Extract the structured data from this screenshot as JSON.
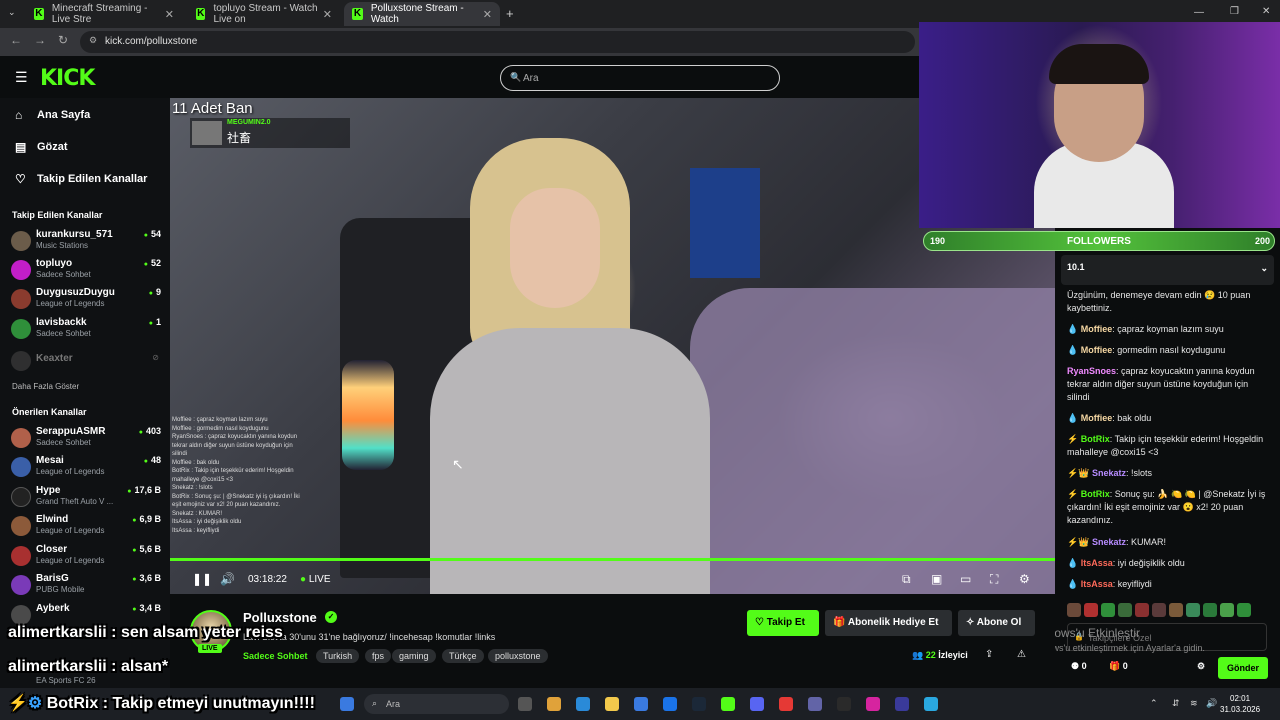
{
  "browser": {
    "tabs": [
      {
        "title": "Minecraft Streaming - Live Stre",
        "active": false
      },
      {
        "title": "topluyo Stream - Watch Live on",
        "active": false
      },
      {
        "title": "Polluxstone Stream - Watch",
        "active": true
      }
    ],
    "url": "kick.com/polluxstone"
  },
  "header": {
    "logo": "KICK",
    "search_placeholder": "Ara"
  },
  "sidebar": {
    "nav": [
      {
        "label": "Ana Sayfa",
        "icon": "home-icon"
      },
      {
        "label": "Gözat",
        "icon": "browse-icon"
      },
      {
        "label": "Takip Edilen Kanallar",
        "icon": "heart-icon"
      }
    ],
    "followed_title": "Takip Edilen Kanallar",
    "followed": [
      {
        "name": "kurankursu_571",
        "category": "Music Stations",
        "viewers": "54",
        "color": "#6b5c4a"
      },
      {
        "name": "topluyo",
        "category": "Sadece Sohbet",
        "viewers": "52",
        "color": "#c21ec8"
      },
      {
        "name": "DuygusuzDuygu",
        "category": "League of Legends",
        "viewers": "9",
        "color": "#8a3b2e"
      },
      {
        "name": "lavisbackk",
        "category": "Sadece Sohbet",
        "viewers": "1",
        "color": "#2f8f3a"
      }
    ],
    "offline": "Keaxter",
    "more_label": "Daha Fazla Göster",
    "recommended_title": "Önerilen Kanallar",
    "recommended": [
      {
        "name": "SerappuASMR",
        "category": "Sadece Sohbet",
        "viewers": "403",
        "color": "#b0604a"
      },
      {
        "name": "Mesai",
        "category": "League of Legends",
        "viewers": "48",
        "color": "#3a5fa8"
      },
      {
        "name": "Hype",
        "category": "Grand Theft Auto V ...",
        "viewers": "17,6 B",
        "color": "#222"
      },
      {
        "name": "Elwind",
        "category": "League of Legends",
        "viewers": "6,9 B",
        "color": "#8c5a3a"
      },
      {
        "name": "Closer",
        "category": "League of Legends",
        "viewers": "5,6 B",
        "color": "#a83030"
      },
      {
        "name": "BarisG",
        "category": "PUBG Mobile",
        "viewers": "3,6 B",
        "color": "#7a3ab8"
      },
      {
        "name": "Ayberk",
        "category": "",
        "viewers": "3,4 B",
        "color": "#4a4a4a"
      }
    ],
    "partial_category": "EA Sports FC 26"
  },
  "video": {
    "ban_overlay": "11 Adet Ban",
    "overlay_user": "MEGUMIN2.0",
    "overlay_text": "社畜",
    "overlay_chat": [
      "Moffiee : çapraz koyman lazım suyu",
      "Moffiee : gormedim nasıl koydugunu",
      "RyanSnoes : çapraz koyucaktın yanına koydun tekrar aldın diğer suyun üstüne koyduğun için silindi",
      "Moffiee : bak oldu",
      "BotRix : Takip için teşekkür ederim! Hoşgeldin mahalleye @coxi15 <3",
      "Snekatz : !slots",
      "BotRix : Sonuç şu: | @Snekatz iyi iş çıkardın! İki eşit emojiniz var x2! 20 puan kazandınız.",
      "Snekatz : KUMAR!",
      "ItsAssa : iyi değişiklik oldu",
      "ItsAssa : keyifliydi"
    ],
    "time": "03:18:22",
    "live_label": "LIVE"
  },
  "webcam": {
    "follow_goal": {
      "current": "190",
      "label": "FOLLOWERS",
      "target": "200",
      "progress": 0.95
    }
  },
  "chat": {
    "pinned": "10.1",
    "messages": [
      {
        "user": "",
        "color": "#fff",
        "text": "Üzgünüm, denemeye devam edin 😢 10 puan kaybettiniz."
      },
      {
        "user": "Moffiee",
        "color": "#f5d7a3",
        "text": "çapraz koyman lazım suyu"
      },
      {
        "user": "Moffiee",
        "color": "#f5d7a3",
        "text": "gormedim nasıl koydugunu"
      },
      {
        "user": "RyanSnoes",
        "color": "#f08aff",
        "text": "çapraz koyucaktın yanına koydun tekrar aldın diğer suyun üstüne koyduğun için silindi"
      },
      {
        "user": "Moffiee",
        "color": "#f5d7a3",
        "text": "bak oldu"
      },
      {
        "user": "BotRix",
        "color": "#53fc18",
        "text": "Takip için teşekkür ederim! Hoşgeldin mahalleye @coxi15 <3"
      },
      {
        "user": "Snekatz",
        "color": "#b78cff",
        "text": "!slots"
      },
      {
        "user": "BotRix",
        "color": "#53fc18",
        "text": "Sonuç şu: 🍌 🍋 🍋 | @Snekatz İyi iş çıkardın! İki eşit emojiniz var 😮 x2! 20 puan kazandınız."
      },
      {
        "user": "Snekatz",
        "color": "#b78cff",
        "text": "KUMAR!"
      },
      {
        "user": "ItsAssa",
        "color": "#ff6a5a",
        "text": "iyi değişiklik oldu"
      },
      {
        "user": "ItsAssa",
        "color": "#ff6a5a",
        "text": "keyifliydi"
      }
    ],
    "input_placeholder": "Takipçilere Özel",
    "points": "0",
    "gifts": "0",
    "send_label": "Gönder"
  },
  "watermark": {
    "title": "Windows'u Etkinleştir",
    "sub": "Windows'u etkinleştirmek için Ayarlar'a gidin."
  },
  "stream_info": {
    "channel": "Polluxstone",
    "live": "LIVE",
    "title": "Lavi Slot'ta 30'unu 31'ne bağlıyoruz/ !incehesap !komutlar !links",
    "category": "Sadece Sohbet",
    "tags": [
      "Turkish",
      "fps",
      "gaming",
      "Türkçe",
      "polluxstone"
    ],
    "follow_label": "Takip Et",
    "gift_label": "Abonelik Hediye Et",
    "sub_label": "Abone Ol",
    "viewers": "22",
    "viewers_label": "İzleyici"
  },
  "overlay_big": [
    {
      "user": "alimertkarslii",
      "text": "sen alsam yeter reiss"
    },
    {
      "user": "alimertkarslii",
      "text": "alsan*"
    },
    {
      "user": "BotRix",
      "text": "Takip etmeyi unutmayın!!!!"
    }
  ],
  "taskbar": {
    "search": "Ara",
    "time": "02:01",
    "date": "31.03.2026"
  }
}
